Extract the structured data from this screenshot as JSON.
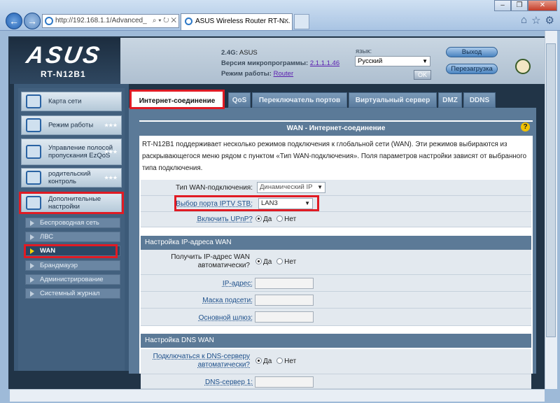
{
  "browser": {
    "address": "http://192.168.1.1/Advanced_",
    "address_tools": "⌕ ▾ ↻ ✕",
    "tab_title": "ASUS Wireless Router RT-N...",
    "tab_close": "✕",
    "right_icons": [
      "⌂",
      "☆",
      "⚙"
    ],
    "window_buttons": [
      "–",
      "❐",
      "✕"
    ]
  },
  "header": {
    "logo_text": "ASUS",
    "model": "RT-N12B1",
    "ssid_label": "2.4G:",
    "ssid_value": "ASUS",
    "firmware_label": "Версия микропрограммы:",
    "firmware_value": "2.1.1.1.46",
    "mode_label": "Режим работы:",
    "mode_value": "Router",
    "lang_label": "язык:",
    "lang_value": "Русский",
    "ok_label": "OK",
    "logout_label": "Выход",
    "reboot_label": "Перезагрузка"
  },
  "sidebar": {
    "items": [
      {
        "label": "Карта сети"
      },
      {
        "label": "Режим работы"
      },
      {
        "label": "Управление полосой пропускания EzQoS"
      },
      {
        "label": "родительский контроль"
      },
      {
        "label": "Дополнительные настройки"
      }
    ],
    "sub_items": [
      {
        "label": "Беспроводная сеть"
      },
      {
        "label": "ЛВС"
      },
      {
        "label": "WAN"
      },
      {
        "label": "Брандмауэр"
      },
      {
        "label": "Администрирование"
      },
      {
        "label": "Системный журнал"
      }
    ]
  },
  "tabs": [
    "Интернет-соединение",
    "QoS",
    "Переключатель портов",
    "Виртуальный сервер",
    "DMZ",
    "DDNS"
  ],
  "panel": {
    "title": "WAN - Интернет-соединение",
    "help": "?",
    "description": "RT-N12B1 поддерживает несколько режимов подключения к глобальной сети (WAN). Эти режимов выбираются из раскрывающегося меню рядом с пунктом «Тип WAN-подключения». Поля параметров настройки зависят от выбранного типа подключения.",
    "wan_type_label": "Тип WAN-подключения:",
    "wan_type_value": "Динамический IP",
    "iptv_label": "Выбор порта IPTV STB:",
    "iptv_value": "LAN3",
    "upnp_label": "Включить UPnP?",
    "yes": "Да",
    "no": "Нет",
    "ip_section": "Настройка IP-адреса WAN",
    "ip_auto_label": "Получить IP-адрес WAN автоматически?",
    "ip_label": "IP-адрес:",
    "mask_label": "Маска подсети:",
    "gw_label": "Основной шлюз:",
    "dns_section": "Настройка DNS WAN",
    "dns_auto_label": "Подключаться к DNS-серверу автоматически?",
    "dns1_label": "DNS-сервер 1:"
  },
  "colors": {
    "highlight": "#e01b24",
    "accent": "#5c7a97"
  }
}
